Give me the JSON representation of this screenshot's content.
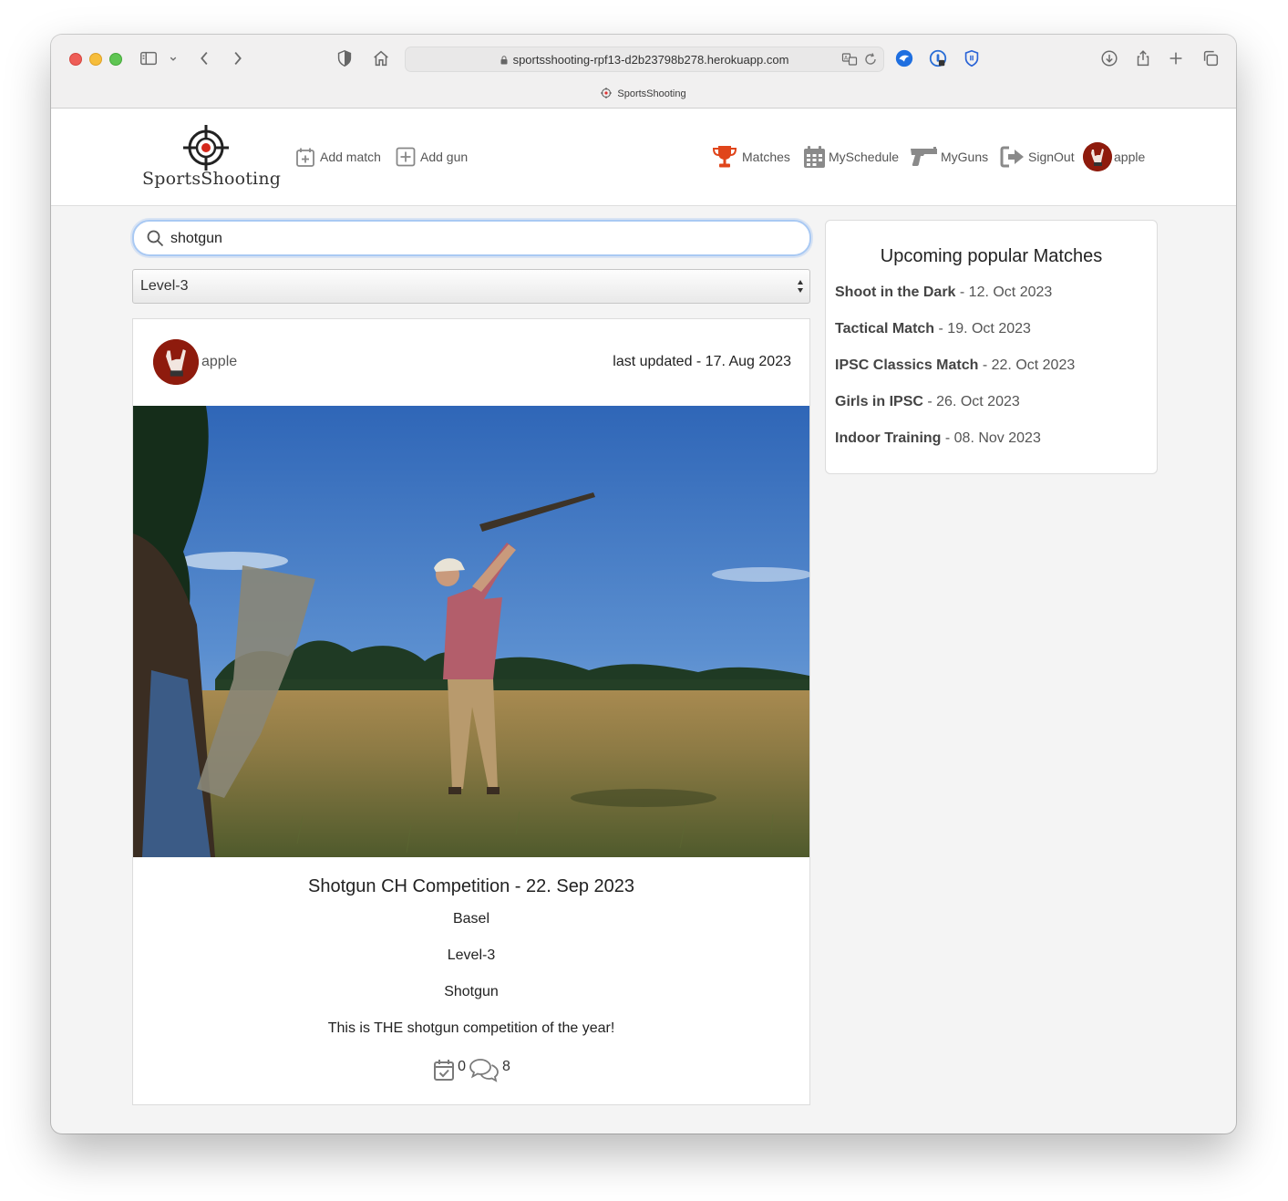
{
  "browser": {
    "url": "sportsshooting-rpf13-d2b23798b278.herokuapp.com",
    "tab_title": "SportsShooting"
  },
  "site": {
    "logo_text": "SportsShooting",
    "nav": {
      "add_match": "Add match",
      "add_gun": "Add gun",
      "matches": "Matches",
      "my_schedule": "MySchedule",
      "my_guns": "MyGuns",
      "sign_out": "SignOut",
      "user": "apple"
    },
    "accent_color": "#e0451b"
  },
  "search": {
    "value": "shotgun",
    "placeholder": ""
  },
  "filter": {
    "selected": "Level-3"
  },
  "match_card": {
    "user": "apple",
    "last_updated": "last updated - 17. Aug 2023",
    "title": "Shotgun CH Competition - 22. Sep 2023",
    "location": "Basel",
    "level": "Level-3",
    "category": "Shotgun",
    "description": "This is THE shotgun competition of the year!",
    "schedule_count": "0",
    "comment_count": "8"
  },
  "popular": {
    "heading": "Upcoming popular Matches",
    "items": [
      {
        "name": "Shoot in the Dark",
        "date": " - 12. Oct 2023"
      },
      {
        "name": "Tactical Match",
        "date": " - 19. Oct 2023"
      },
      {
        "name": "IPSC Classics Match",
        "date": " - 22. Oct 2023"
      },
      {
        "name": "Girls in IPSC",
        "date": " - 26. Oct 2023"
      },
      {
        "name": "Indoor Training",
        "date": " - 08. Nov 2023"
      }
    ]
  }
}
